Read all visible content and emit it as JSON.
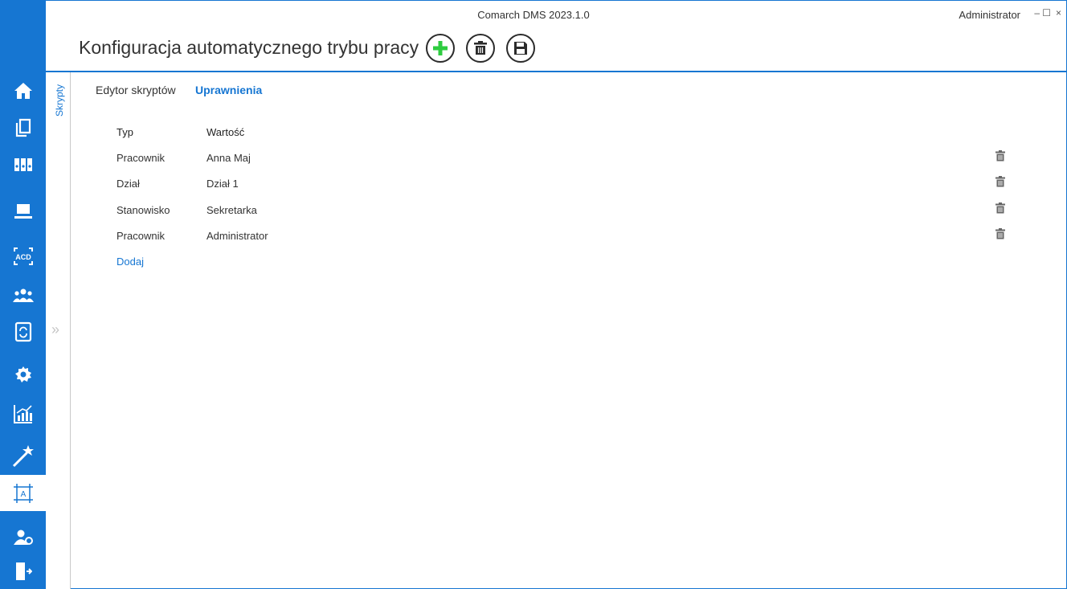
{
  "window": {
    "app_title": "Comarch DMS 2023.1.0",
    "user": "Administrator",
    "minimize": "–",
    "maximize": "☐",
    "close": "×"
  },
  "page": {
    "title": "Konfiguracja automatycznego trybu pracy"
  },
  "toolbar": {
    "add_icon": "plus-icon",
    "delete_icon": "trash-icon",
    "save_icon": "floppy-disk-icon",
    "accent_add": "#2ecc40"
  },
  "side_panel": {
    "label": "Skrypty",
    "expander": "»"
  },
  "tabs": [
    {
      "label": "Edytor skryptów",
      "active": false
    },
    {
      "label": "Uprawnienia",
      "active": true
    }
  ],
  "table": {
    "headers": [
      "Typ",
      "Wartość"
    ],
    "rows": [
      {
        "typ": "Pracownik",
        "wartosc": "Anna Maj"
      },
      {
        "typ": "Dział",
        "wartosc": "Dział 1"
      },
      {
        "typ": "Stanowisko",
        "wartosc": "Sekretarka"
      },
      {
        "typ": "Pracownik",
        "wartosc": "Administrator"
      }
    ],
    "add_label": "Dodaj"
  },
  "leftbar": {
    "items": [
      "home-icon",
      "documents-icon",
      "binders-icon",
      "workstation-icon",
      "ocr-icon",
      "users-icon",
      "document-sync-icon",
      "settings-icon",
      "reports-icon",
      "magic-wand-icon",
      "designer-icon",
      "user-settings-icon",
      "logout-icon"
    ],
    "active": "designer-icon"
  },
  "colors": {
    "accent": "#1676d2",
    "text": "#333333"
  }
}
